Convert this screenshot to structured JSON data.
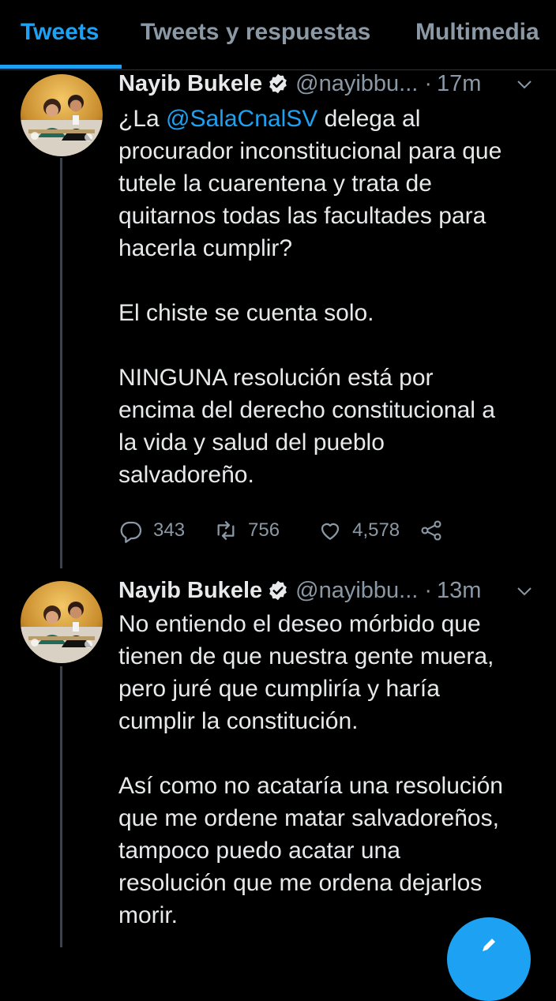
{
  "tabs": {
    "tweets": "Tweets",
    "replies": "Tweets y respuestas",
    "media": "Multimedia"
  },
  "colors": {
    "accent": "#1da1f2",
    "background": "#000000",
    "text": "#e7e9ea",
    "muted": "#8b98a5"
  },
  "tweets": [
    {
      "name": "Nayib Bukele",
      "handle": "@nayibbu...",
      "dot": "·",
      "time": "17m",
      "lines": {
        "l1_pre": "¿La ",
        "l1_mention": "@SalaCnalSV",
        "l1_post": " delega al",
        "l2": "procurador inconstitucional para que",
        "l3": "tutele la cuarentena y trata de",
        "l4": "quitarnos todas las facultades para",
        "l5": "hacerla cumplir?",
        "l6": "El chiste se cuenta solo.",
        "l7": "NINGUNA resolución está por",
        "l8": "encima del derecho constitucional a",
        "l9": "la vida y salud del pueblo",
        "l10": "salvadoreño."
      },
      "replies": "343",
      "retweets": "756",
      "likes": "4,578"
    },
    {
      "name": "Nayib Bukele",
      "handle": "@nayibbu...",
      "dot": "·",
      "time": "13m",
      "lines": {
        "l1": "No entiendo el deseo mórbido que",
        "l2": "tienen de que nuestra gente muera,",
        "l3": "pero juré que cumpliría y haría",
        "l4": "cumplir la constitución.",
        "l5": "Así como no acataría una resolución",
        "l6": "que me ordene matar salvadoreños,",
        "l7": "tampoco puedo acatar una",
        "l8": "resolución que me ordena dejarlos",
        "l9": "morir."
      }
    }
  ],
  "icons": {
    "verified": "verified-badge-icon",
    "reply": "reply-icon",
    "retweet": "retweet-icon",
    "like": "heart-icon",
    "share": "share-icon",
    "more": "chevron-down-icon",
    "compose": "compose-icon"
  }
}
